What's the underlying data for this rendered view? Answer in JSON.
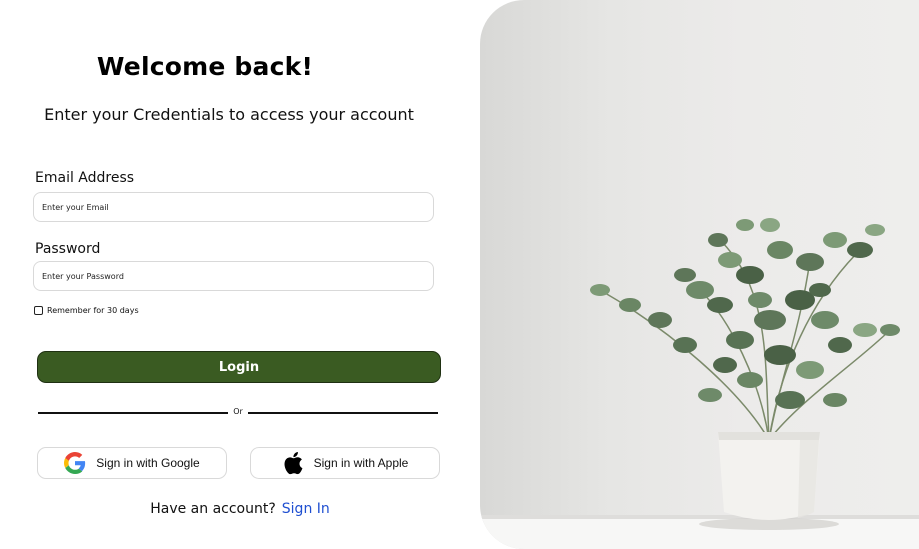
{
  "header": {
    "title": "Welcome back!",
    "subtitle": "Enter your Credentials to access your account"
  },
  "form": {
    "email_label": "Email Address",
    "email_placeholder": "Enter your Email",
    "email_value": "",
    "password_label": "Password",
    "password_placeholder": "Enter your Password",
    "password_value": "",
    "remember_label": "Remember for 30 days",
    "remember_checked": false,
    "login_label": "Login"
  },
  "divider": {
    "label": "Or"
  },
  "social": {
    "google": {
      "label": "Sign in with Google",
      "icon": "google-icon"
    },
    "apple": {
      "label": "Sign in with Apple",
      "icon": "apple-icon"
    }
  },
  "footer": {
    "prompt": "Have an account?",
    "link": "Sign In"
  },
  "colors": {
    "primary_button": "#3a5b22",
    "link": "#1f4fd1",
    "border": "#d9d9d9"
  }
}
